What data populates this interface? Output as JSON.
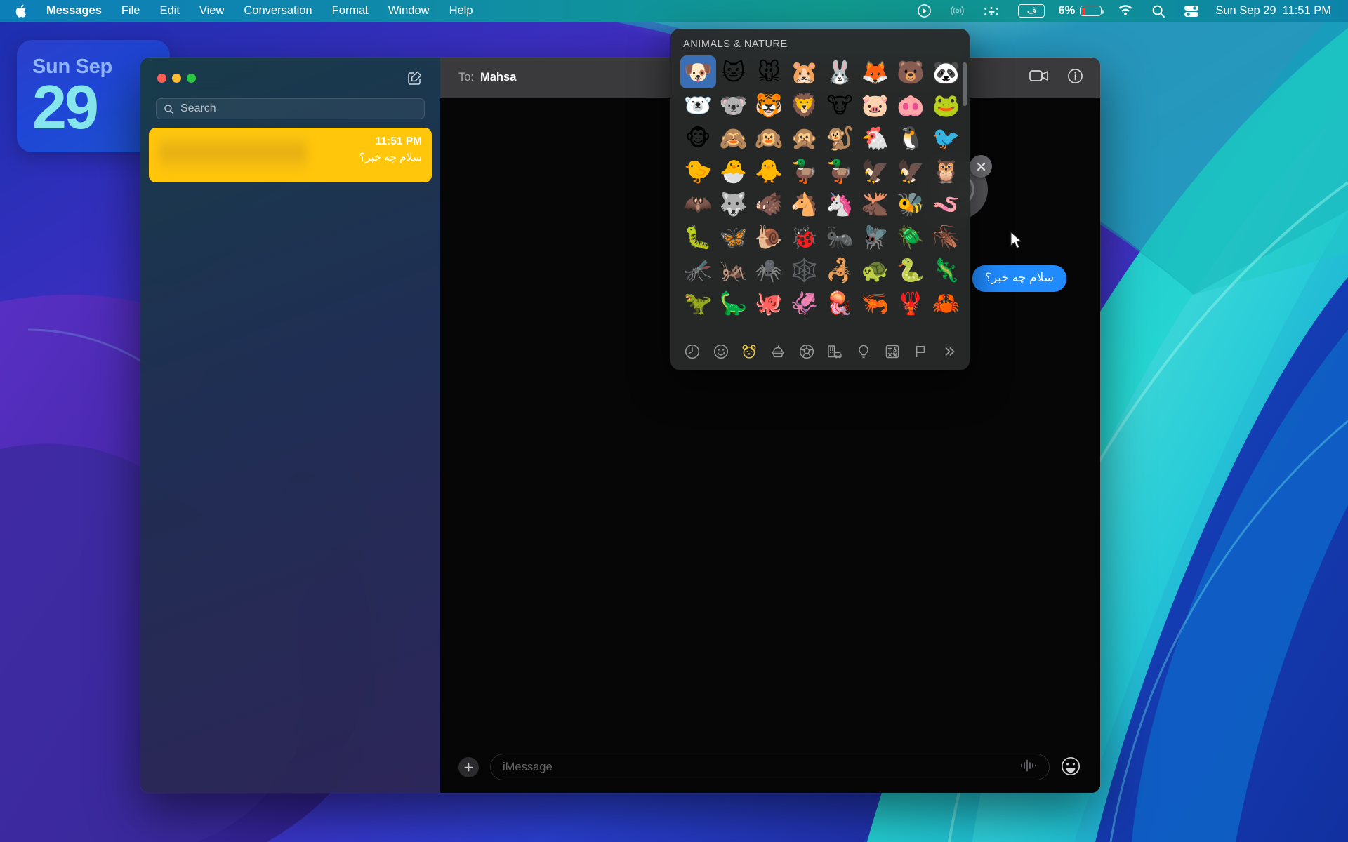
{
  "menubar": {
    "apple_icon": "apple-logo-icon",
    "items": [
      {
        "label": "Messages",
        "bold": true
      },
      {
        "label": "File",
        "bold": false
      },
      {
        "label": "Edit",
        "bold": false
      },
      {
        "label": "View",
        "bold": false
      },
      {
        "label": "Conversation",
        "bold": false
      },
      {
        "label": "Format",
        "bold": false
      },
      {
        "label": "Window",
        "bold": false
      },
      {
        "label": "Help",
        "bold": false
      }
    ],
    "status_icons": [
      "screen-recording-icon",
      "airplay-icon",
      "braille-dots-icon",
      "keyboard-input-icon",
      "wifi-icon",
      "spotlight-search-icon",
      "control-center-icon"
    ],
    "keyboard_input_badge": "ف",
    "battery_percent": "6%",
    "clock_date": "Sun Sep 29",
    "clock_time": "11:51 PM"
  },
  "date_widget": {
    "day_of_week": "Sun Sep",
    "day_number": "29"
  },
  "messages_window": {
    "sidebar": {
      "traffic_lights": [
        "close",
        "minimize",
        "zoom"
      ],
      "compose_label": "compose-new-message",
      "search": {
        "placeholder": "Search",
        "value": ""
      },
      "conversations": [
        {
          "name": "",
          "name_redacted": true,
          "time": "11:51 PM",
          "snippet": "سلام چه خبر؟",
          "selected": true
        }
      ]
    },
    "conversation": {
      "to_label": "To:",
      "to_name": "Mahsa",
      "toolbar_actions": [
        "facetime-video-icon",
        "info-icon"
      ],
      "messages": [
        {
          "text": "سلام چه خبر؟",
          "direction": "outgoing",
          "color": "#1f8bff"
        }
      ],
      "tapback_popup": {
        "visible": true,
        "icon": "smiley-face-icon",
        "close_label": "close-tapback"
      },
      "composer": {
        "add_label": "add-attachment",
        "placeholder": "iMessage",
        "value": "",
        "dictate_label": "audio-waveform-icon",
        "emoji_label": "emoji-picker-button"
      }
    }
  },
  "emoji_picker": {
    "category_title": "ANIMALS & NATURE",
    "selected_index": 0,
    "emojis": [
      "🐶",
      "🐱",
      "🐭",
      "🐹",
      "🐰",
      "🦊",
      "🐻",
      "🐼",
      "🐻‍❄️",
      "🐨",
      "🐯",
      "🦁",
      "🐮",
      "🐷",
      "🐽",
      "🐸",
      "🐵",
      "🙈",
      "🙉",
      "🙊",
      "🐒",
      "🐔",
      "🐧",
      "🐦",
      "🐤",
      "🐣",
      "🐥",
      "🦆",
      "🦆",
      "🦅",
      "🦅",
      "🦉",
      "🦇",
      "🐺",
      "🐗",
      "🐴",
      "🦄",
      "🫎",
      "🐝",
      "🪱",
      "🐛",
      "🦋",
      "🐌",
      "🐞",
      "🐜",
      "🪰",
      "🪲",
      "🪳",
      "🦟",
      "🦗",
      "🕷️",
      "🕸️",
      "🦂",
      "🐢",
      "🐍",
      "🦎",
      "🦖",
      "🦕",
      "🐙",
      "🦑",
      "🪼",
      "🦐",
      "🦞",
      "🦀"
    ],
    "emoji_names": [
      "dog-face",
      "cat-face",
      "mouse-face",
      "hamster",
      "rabbit-face",
      "fox",
      "bear",
      "panda",
      "polar-bear",
      "koala",
      "tiger-face",
      "lion",
      "cow-face",
      "pig-face",
      "pig-nose",
      "frog",
      "monkey-face",
      "see-no-evil-monkey",
      "hear-no-evil-monkey",
      "speak-no-evil-monkey",
      "monkey",
      "chicken",
      "penguin",
      "bird",
      "baby-chick",
      "hatching-chick",
      "front-facing-baby-chick",
      "goose",
      "duck",
      "black-bird",
      "eagle",
      "owl",
      "bat",
      "wolf",
      "boar",
      "horse-face",
      "unicorn",
      "moose",
      "honeybee",
      "worm",
      "caterpillar",
      "butterfly",
      "snail",
      "lady-beetle",
      "ant",
      "fly",
      "beetle",
      "cockroach",
      "mosquito",
      "cricket",
      "spider",
      "spider-web",
      "scorpion",
      "turtle",
      "snake",
      "lizard",
      "t-rex",
      "sauropod",
      "octopus",
      "squid",
      "jellyfish",
      "shrimp",
      "lobster",
      "crab"
    ],
    "tabs": [
      {
        "name": "recents-tab",
        "icon": "clock-icon",
        "active": false
      },
      {
        "name": "smileys-people-tab",
        "icon": "smiley-icon",
        "active": false
      },
      {
        "name": "animals-nature-tab",
        "icon": "bear-face-icon",
        "active": true
      },
      {
        "name": "food-drink-tab",
        "icon": "food-icon",
        "active": false
      },
      {
        "name": "activity-tab",
        "icon": "soccer-ball-icon",
        "active": false
      },
      {
        "name": "travel-places-tab",
        "icon": "car-building-icon",
        "active": false
      },
      {
        "name": "objects-tab",
        "icon": "lightbulb-icon",
        "active": false
      },
      {
        "name": "symbols-tab",
        "icon": "symbols-icon",
        "active": false
      },
      {
        "name": "flags-tab",
        "icon": "flag-icon",
        "active": false
      },
      {
        "name": "more-tab",
        "icon": "double-chevron-right-icon",
        "active": false
      }
    ],
    "active_tab_color": "#e8c84a"
  }
}
